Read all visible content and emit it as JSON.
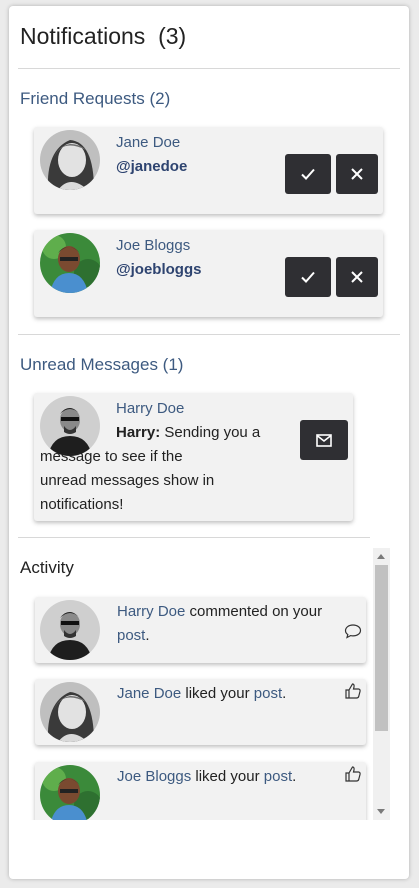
{
  "header": {
    "title": "Notifications",
    "count": "(3)"
  },
  "friend_requests": {
    "title": "Friend Requests (2)",
    "items": [
      {
        "name": "Jane Doe",
        "handle": "@janedoe",
        "avatar": "woman-avatar"
      },
      {
        "name": "Joe Bloggs",
        "handle": "@joebloggs",
        "avatar": "man-green-avatar"
      }
    ]
  },
  "messages": {
    "title": "Unread Messages (1)",
    "items": [
      {
        "name": "Harry Doe",
        "sender": "Harry:",
        "lines": [
          "Sending you a",
          "message to see if the",
          "unread messages show in",
          "notifications!"
        ]
      }
    ]
  },
  "activity": {
    "title": "Activity",
    "items": [
      {
        "name": "Harry Doe",
        "text": " commented on your",
        "link": "post",
        "end": ".",
        "icon": "comment-icon"
      },
      {
        "name": "Jane Doe",
        "text": " liked your ",
        "link": "post",
        "end": ".",
        "icon": "thumbs-up-icon"
      },
      {
        "name": "Joe Bloggs",
        "text": " liked your ",
        "link": "post",
        "end": ".",
        "icon": "thumbs-up-icon"
      }
    ]
  },
  "colors": {
    "link": "#3d5a80",
    "button": "#2f2f33",
    "card": "#f2f2f2"
  }
}
